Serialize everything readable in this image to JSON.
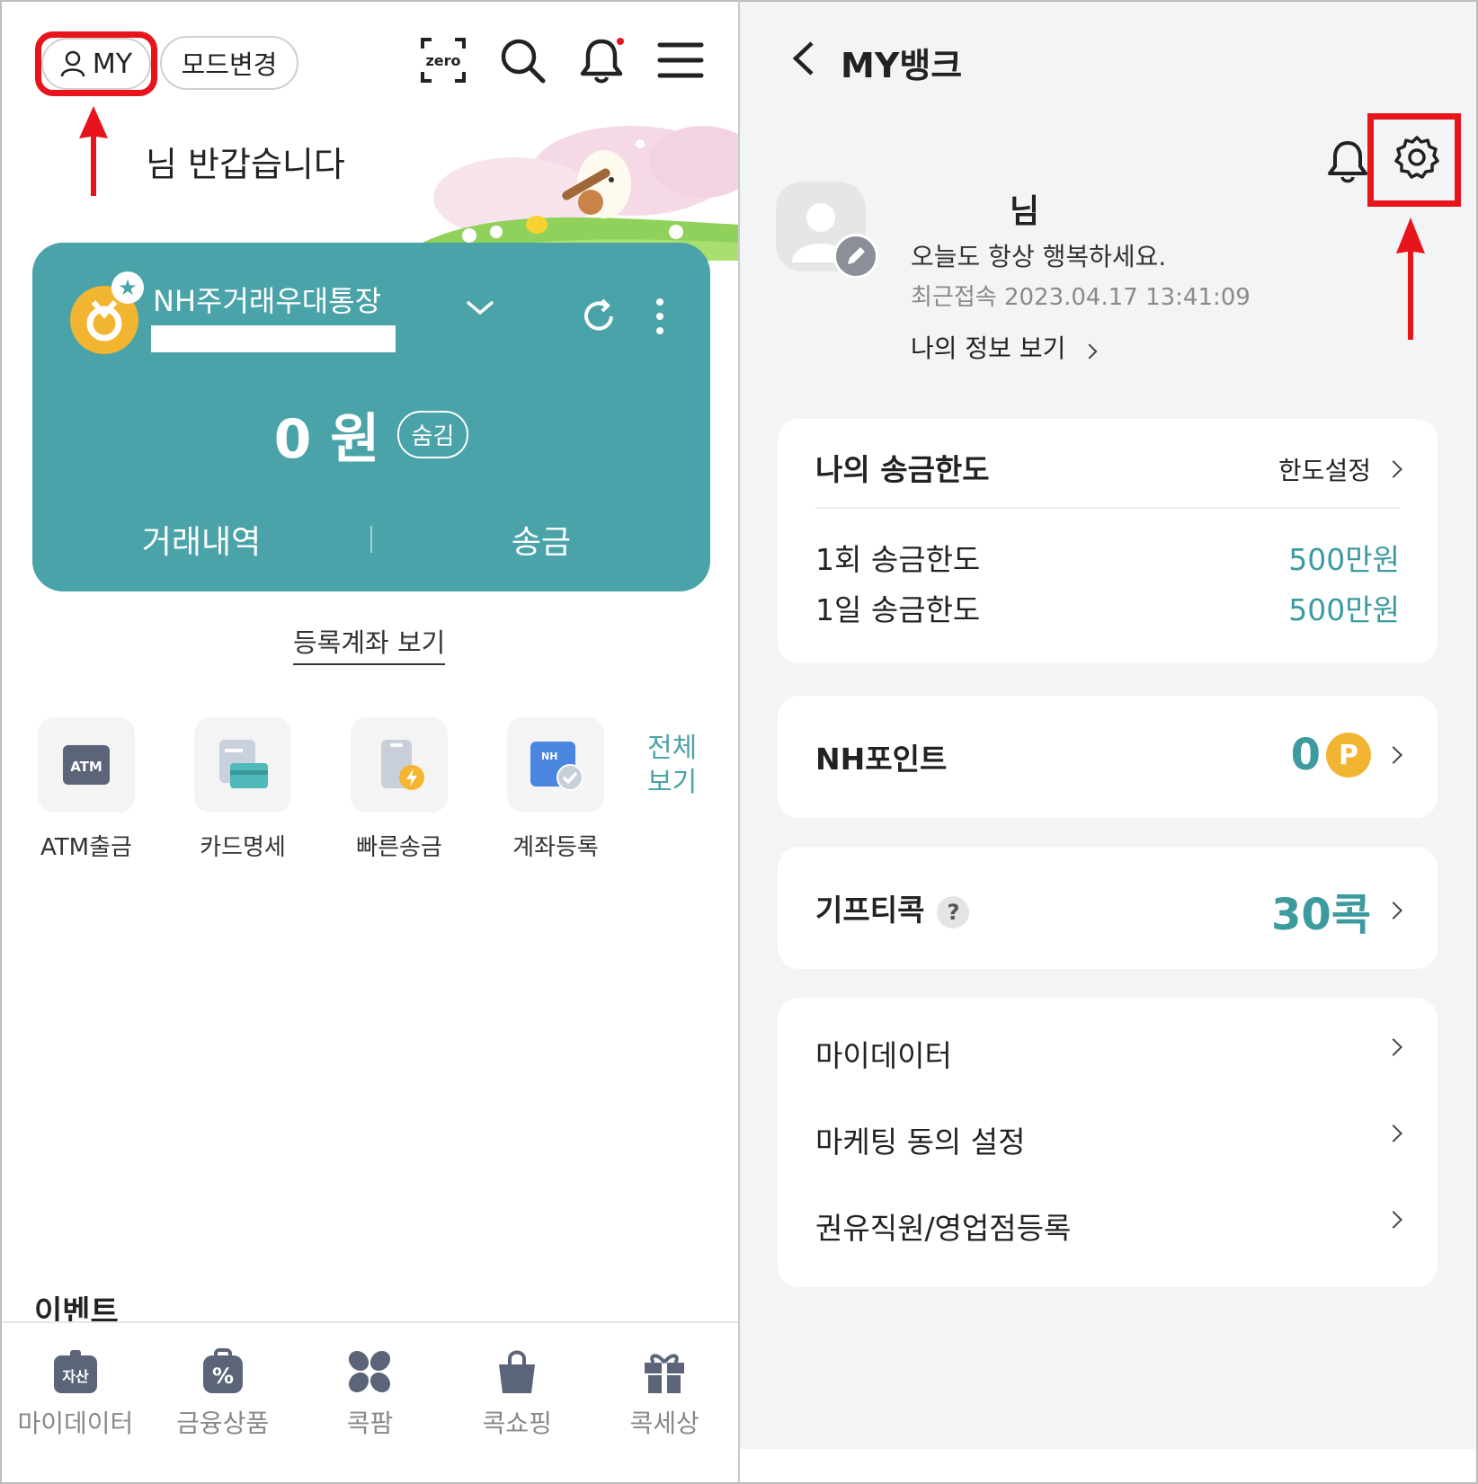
{
  "left": {
    "header": {
      "my_label": "MY",
      "mode_label": "모드변경",
      "icons": [
        "zeropay-icon",
        "search-icon",
        "bell-icon",
        "menu-icon"
      ]
    },
    "greeting": "님 반갑습니다",
    "account": {
      "name": "NH주거래우대통장",
      "balance": "0 원",
      "hide_label": "숨김",
      "actions": [
        "거래내역",
        "송금"
      ]
    },
    "registered_link": "등록계좌 보기",
    "quick_menu": {
      "items": [
        {
          "label": "ATM출금",
          "icon": "atm-icon",
          "icon_text": "ATM"
        },
        {
          "label": "카드명세",
          "icon": "card-statement-icon"
        },
        {
          "label": "빠른송금",
          "icon": "quick-transfer-icon"
        },
        {
          "label": "계좌등록",
          "icon": "account-register-icon",
          "icon_text": "NH"
        }
      ],
      "all_label_1": "전체",
      "all_label_2": "보기"
    },
    "event_title": "이벤트",
    "bottom_nav": [
      {
        "label": "마이데이터",
        "icon": "asset-icon",
        "icon_text": "자산"
      },
      {
        "label": "금융상품",
        "icon": "percent-icon"
      },
      {
        "label": "콕팜",
        "icon": "flower-icon"
      },
      {
        "label": "콕쇼핑",
        "icon": "shopping-bag-icon"
      },
      {
        "label": "콕세상",
        "icon": "gift-icon"
      }
    ]
  },
  "right": {
    "title": "MY뱅크",
    "profile": {
      "name": "님",
      "greeting": "오늘도 항상 행복하세요.",
      "last_login": "최근접속 2023.04.17  13:41:09",
      "info_link": "나의 정보 보기"
    },
    "limit": {
      "title": "나의 송금한도",
      "setting": "한도설정",
      "rows": [
        {
          "label": "1회 송금한도",
          "value": "500만원"
        },
        {
          "label": "1일 송금한도",
          "value": "500만원"
        }
      ]
    },
    "points": {
      "label": "NH포인트",
      "value": "0",
      "coin": "P"
    },
    "gifticon": {
      "label": "기프티콕",
      "help": "?",
      "value": "30콕"
    },
    "menu": [
      "마이데이터",
      "마케팅 동의 설정",
      "권유직원/영업점등록"
    ]
  },
  "colors": {
    "accent": "#4aa3a8",
    "highlight": "#e8141b",
    "coin": "#f2b531"
  }
}
